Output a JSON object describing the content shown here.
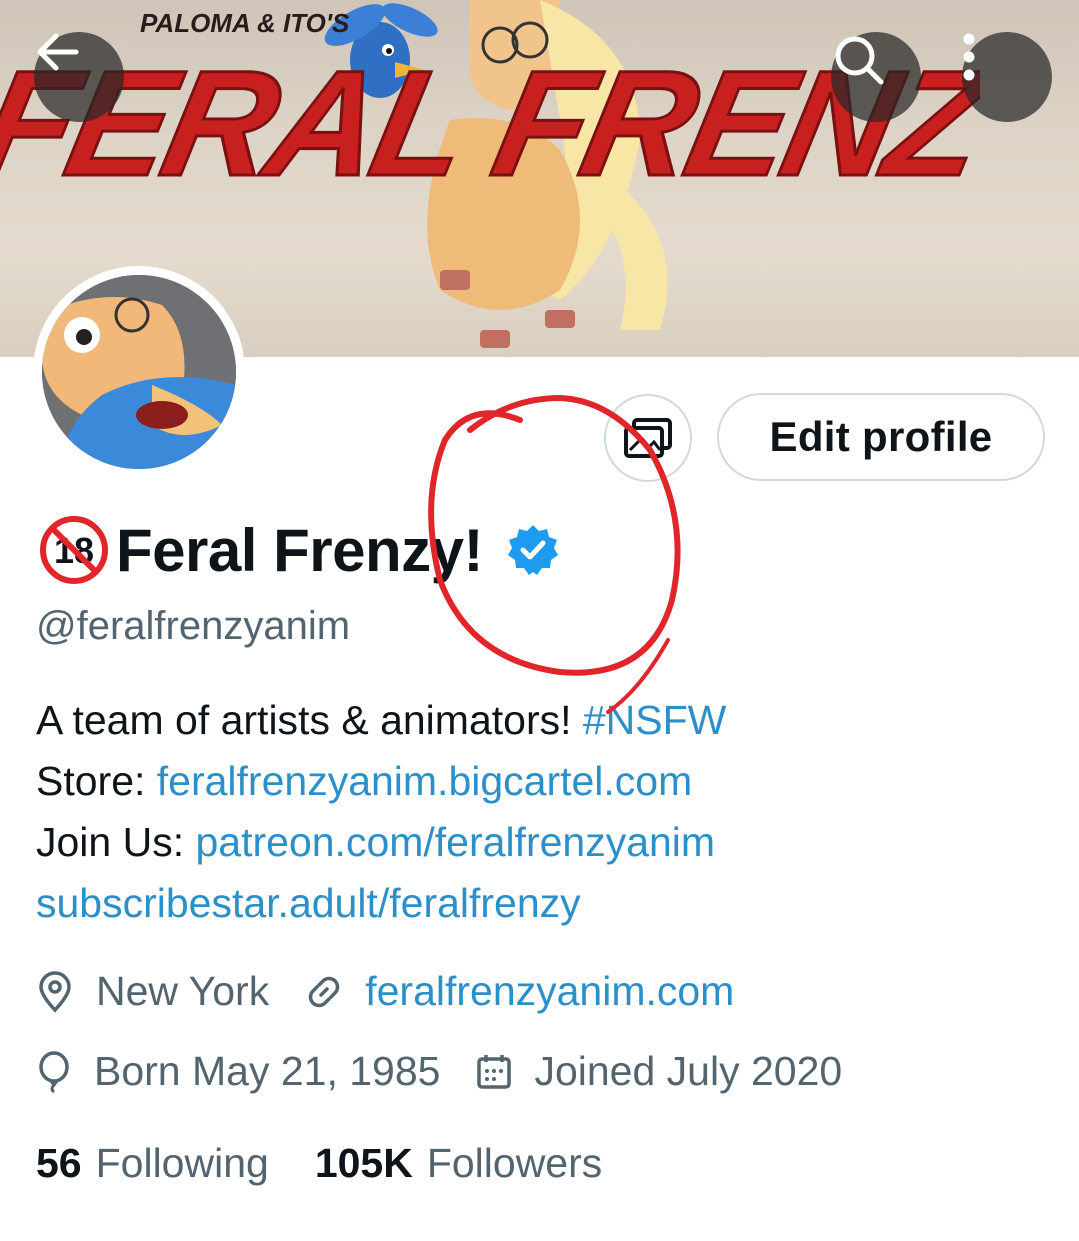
{
  "banner": {
    "subtitle": "PALOMA & ITO'S",
    "title": "FERAL FRENZY!"
  },
  "nav": {
    "back_icon": "arrow-left-icon",
    "search_icon": "search-icon",
    "more_icon": "more-vertical-icon"
  },
  "actions": {
    "edit_profile_label": "Edit profile"
  },
  "profile": {
    "badge_text": "18",
    "display_name": "Feral Frenzy!",
    "handle": "@feralfrenzyanim",
    "bio": {
      "line1_text": "A team of artists & animators! ",
      "line1_tag": "#NSFW",
      "line2_label": "Store: ",
      "line2_link": "feralfrenzyanim.bigcartel.com",
      "line3_label": "Join Us: ",
      "line3_link": "patreon.com/feralfrenzyanim",
      "line4_link": "subscribestar.adult/feralfrenzy"
    },
    "location": "New York",
    "website": "feralfrenzyanim.com",
    "birthday": "Born May 21, 1985",
    "joined": "Joined July 2020",
    "following_count": "56",
    "following_label": "Following",
    "followers_count": "105K",
    "followers_label": "Followers"
  },
  "colors": {
    "accent": "#1d9bf0",
    "verified": "#1d9bf0",
    "annotation": "#e0262b",
    "title_red": "#c8201f"
  }
}
